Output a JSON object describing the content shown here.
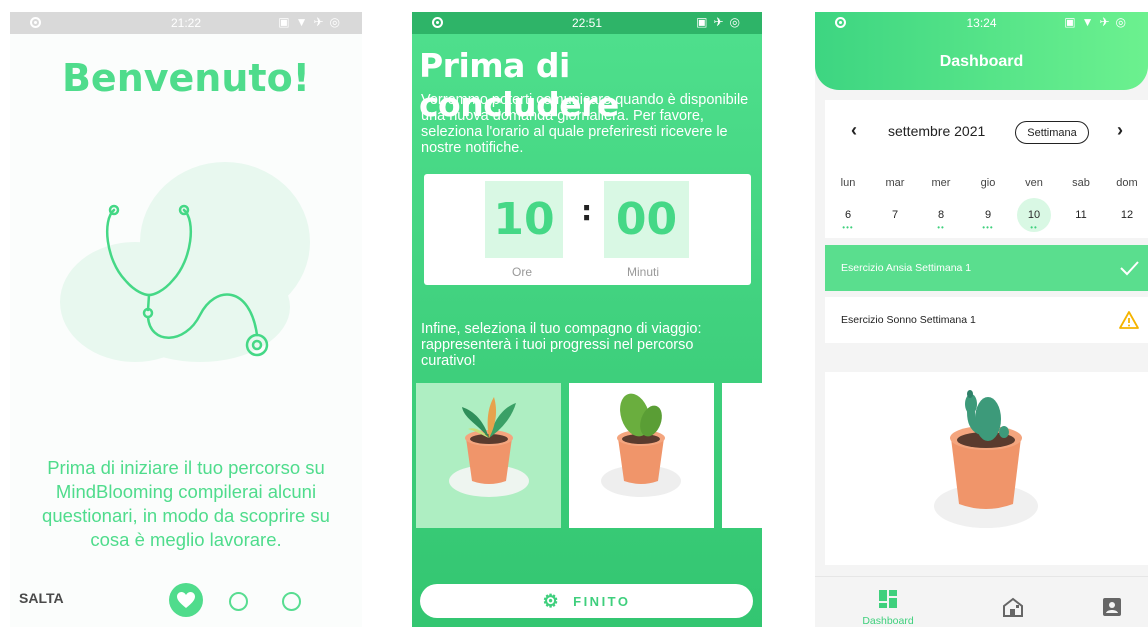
{
  "screen_welcome": {
    "status_time": "21:22",
    "title": "Benvenuto!",
    "intro": "Prima di iniziare il tuo percorso su MindBlooming compilerai alcuni questionari, in modo da scoprire su cosa è meglio lavorare.",
    "skip_label": "SALTA",
    "page_count": 3,
    "active_page": 1
  },
  "screen_notifications": {
    "status_time": "22:51",
    "title": "Prima di concludere",
    "description": "Vorremmo poterti comunicare quando è disponibile una nuova domanda giornaliera. Per favore, seleziona l'orario al quale preferiresti ricevere le nostre notifiche.",
    "hours_value": "10",
    "minutes_value": "00",
    "hours_label": "Ore",
    "minutes_label": "Minuti",
    "companion_text": "Infine, seleziona il tuo compagno di viaggio: rappresenterà i tuoi progressi nel percorso curativo!",
    "finish_label": "FINITO"
  },
  "screen_dashboard": {
    "status_time": "13:24",
    "header_title": "Dashboard",
    "calendar": {
      "month": "settembre 2021",
      "view_toggle": "Settimana",
      "days": [
        {
          "name": "lun",
          "num": "6",
          "marks": "•••"
        },
        {
          "name": "mar",
          "num": "7",
          "marks": ""
        },
        {
          "name": "mer",
          "num": "8",
          "marks": "••"
        },
        {
          "name": "gio",
          "num": "9",
          "marks": "•••"
        },
        {
          "name": "ven",
          "num": "10",
          "marks": "••"
        },
        {
          "name": "sab",
          "num": "11",
          "marks": ""
        },
        {
          "name": "dom",
          "num": "12",
          "marks": ""
        }
      ],
      "selected": "10"
    },
    "tasks": [
      {
        "label": "Esercizio Ansia Settimana 1",
        "status": "done"
      },
      {
        "label": "Esercizio Sonno Settimana 1",
        "status": "warning"
      }
    ],
    "nav": {
      "dashboard_label": "Dashboard"
    }
  },
  "colors": {
    "accent": "#4fdc8c",
    "accent_dark": "#3fcf7d",
    "selected_bg": "#d9f8e4",
    "warning": "#f5b400"
  }
}
